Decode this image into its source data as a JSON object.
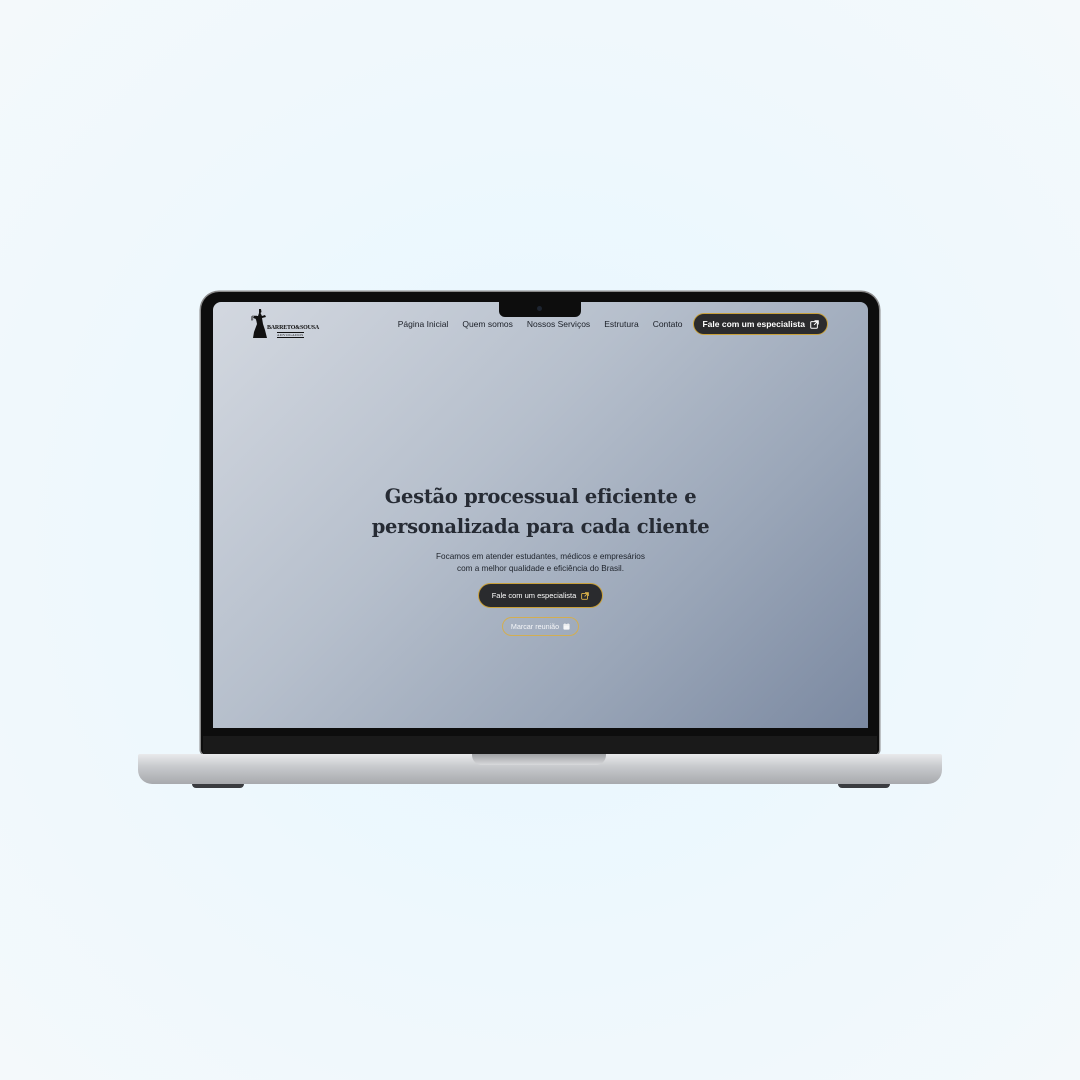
{
  "logo": {
    "name": "BARRETO&SOUSA",
    "tagline": "ADVOGADOS",
    "icon": "lady-justice-icon"
  },
  "nav": {
    "links": [
      "Página Inicial",
      "Quem somos",
      "Nossos Serviços",
      "Estrutura",
      "Contato"
    ],
    "cta_label": "Fale com um especialista",
    "cta_icon": "external-link-icon"
  },
  "hero": {
    "title_line1": "Gestão processual eficiente e",
    "title_line2": "personalizada para cada cliente",
    "subtitle_line1": "Focamos em atender estudantes, médicos e empresários",
    "subtitle_line2": "com a melhor qualidade e eficiência do Brasil.",
    "primary_button": "Fale com um especialista",
    "primary_icon": "external-link-icon",
    "secondary_button": "Marcar reunião",
    "secondary_icon": "calendar-icon"
  },
  "colors": {
    "accent_gold": "#c9a13b",
    "button_dark": "#2a2b2e",
    "heading": "#262b34"
  }
}
